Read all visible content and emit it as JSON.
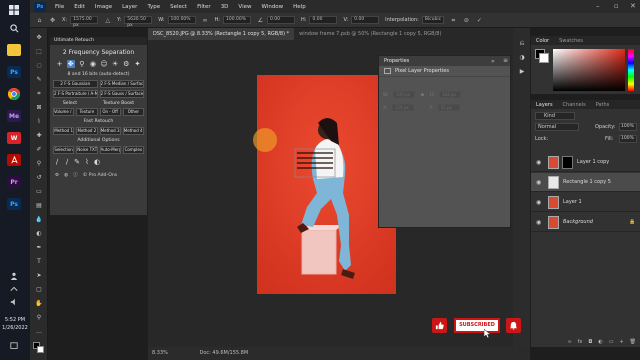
{
  "taskbar": {
    "apps": [
      {
        "name": "file-explorer",
        "label": ""
      },
      {
        "name": "photoshop",
        "label": "Ps"
      },
      {
        "name": "chrome",
        "label": ""
      },
      {
        "name": "media-encoder",
        "label": "Me"
      },
      {
        "name": "wps",
        "label": "W"
      },
      {
        "name": "acrobat",
        "label": ""
      },
      {
        "name": "premiere",
        "label": "Pr"
      },
      {
        "name": "photoshop-2",
        "label": "Ps"
      }
    ],
    "time": "5:52 PM",
    "date": "1/26/2022"
  },
  "menubar": {
    "items": [
      "File",
      "Edit",
      "Image",
      "Layer",
      "Type",
      "Select",
      "Filter",
      "3D",
      "View",
      "Window",
      "Help"
    ]
  },
  "options": {
    "x_label": "X:",
    "x_value": "1575.00 px",
    "y_label": "Y:",
    "y_value": "5630.50 px",
    "w_label": "W:",
    "w_value": "100.00%",
    "h_label": "H:",
    "h_value": "100.00%",
    "angle_value": "0.00",
    "h2_label": "H:",
    "h2_value": "0.00",
    "v_label": "V:",
    "v_value": "0.00",
    "interp_label": "Interpolation:",
    "interp_value": "Bicubic"
  },
  "retouch_panel": {
    "header": "Ultimate Retouch",
    "title": "2 Frequency Separation",
    "subtitle": "8 and 16 bits (auto-detect)",
    "row1": [
      "2 F-S Gaussian",
      "2 F-S Median / Surface"
    ],
    "row2": [
      "2 F-S Portraiture / A-Max",
      "2 F-S Gauss / Surface"
    ],
    "select_header": "Select",
    "texture_header": "Texture Boost",
    "row3": [
      "Volume / A",
      "Texture",
      "On - Off",
      "Other"
    ],
    "fast_header": "Fast Retouch",
    "row4": [
      "Method 1",
      "Method 2",
      "Method 3",
      "Method 4 / A"
    ],
    "addl_header": "Additional Options",
    "row5": [
      "Selection",
      "Noise TXT",
      "Auto-Merge",
      "Complex"
    ],
    "footer": "© Pro Add-Ons"
  },
  "doc_tabs": [
    {
      "label": "DSC_8520.JPG @ 8.33% (Rectangle 1 copy 5, RGB/8) *",
      "active": true
    },
    {
      "label": "window frame 7.psb @ 50% (Rectangle 1 copy 5, RGB/8)",
      "active": false
    }
  ],
  "status": {
    "zoom": "8.33%",
    "doc": "Doc: 49.6M/155.8M"
  },
  "properties": {
    "tab": "Properties",
    "title": "Pixel Layer Properties",
    "w_label": "W:",
    "w_value": "335 px",
    "h_label": "H:",
    "h_value": "102 px",
    "x_label": "X:",
    "x_value": "310 px",
    "y_label": "Y:",
    "y_value": "52 px"
  },
  "color_panel": {
    "tabs": [
      "Color",
      "Swatches"
    ],
    "fg_color": "#000000",
    "hue_color": "#e02a1a"
  },
  "layers_panel": {
    "tabs": [
      "Layers",
      "Channels",
      "Paths"
    ],
    "kind_label": "Kind",
    "blend_mode": "Normal",
    "opacity_label": "Opacity:",
    "opacity_value": "100%",
    "lock_label": "Lock:",
    "fill_label": "Fill:",
    "fill_value": "100%",
    "layers": [
      {
        "name": "Layer 1 copy",
        "selected": false
      },
      {
        "name": "Rectangle 1 copy 5",
        "selected": true
      },
      {
        "name": "Layer 1",
        "selected": false
      },
      {
        "name": "Background",
        "selected": false
      }
    ]
  },
  "overlay": {
    "subscribe_label": "SUBSCRIBED",
    "like_icon": "thumbs-up-icon",
    "bell_icon": "bell-icon",
    "brand_color": "#cc1616"
  }
}
